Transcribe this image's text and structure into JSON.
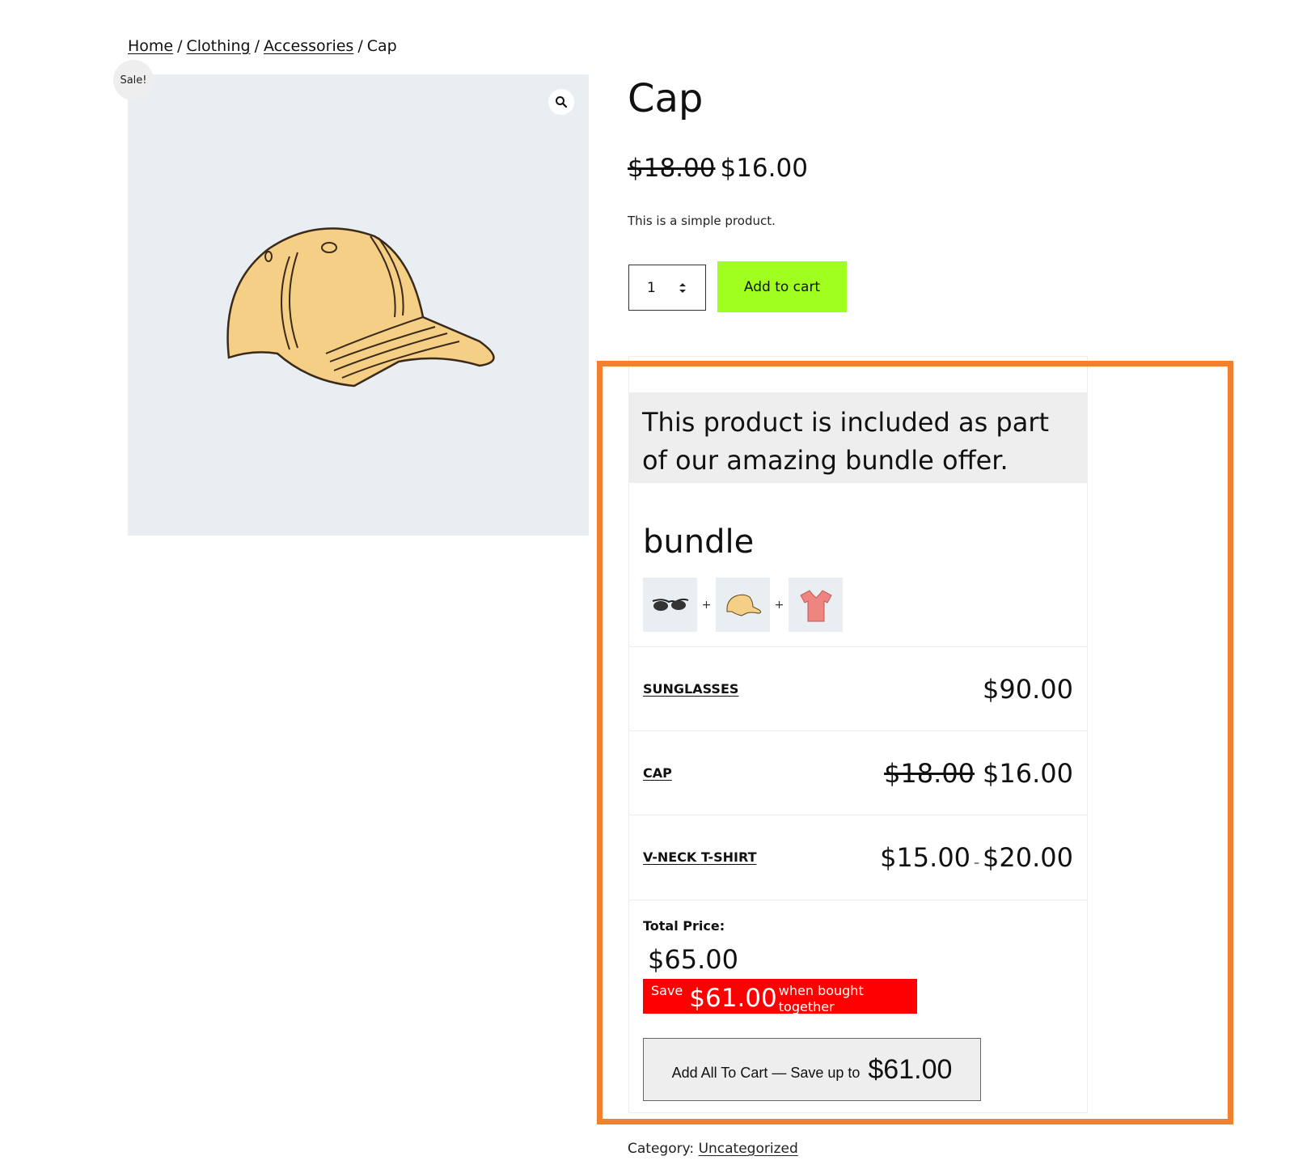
{
  "breadcrumb": {
    "home": "Home",
    "clothing": "Clothing",
    "accessories": "Accessories",
    "current": "Cap",
    "separator": "/"
  },
  "product": {
    "sale_badge": "Sale!",
    "title": "Cap",
    "price_old": "$18.00",
    "price_new": "$16.00",
    "short_description": "This is a simple product.",
    "quantity": "1",
    "add_to_cart_label": "Add to cart",
    "category_label": "Category:",
    "category_value": "Uncategorized"
  },
  "bundle": {
    "banner_text": "This product is included as part of our amazing bundle offer.",
    "title": "bundle",
    "thumb_separator": "+",
    "thumbnails": [
      "sunglasses-icon",
      "cap-icon",
      "t-shirt-icon"
    ],
    "items": [
      {
        "name": "SUNGLASSES",
        "price": "$90.00"
      },
      {
        "name": "CAP",
        "price_old": "$18.00",
        "price": "$16.00"
      },
      {
        "name": "V-NECK T-SHIRT",
        "price_min": "$15.00",
        "price_dash": "–",
        "price_max": "$20.00"
      }
    ],
    "total_label": "Total Price:",
    "total_value": "$65.00",
    "save_prefix": "Save",
    "save_amount": "$61.00",
    "save_suffix": "when bought together",
    "add_all_label": "Add All To Cart — Save up to",
    "add_all_amount": "$61.00"
  },
  "colors": {
    "add_to_cart_bg": "#a0ff1f",
    "highlight_border": "#f2802e",
    "save_badge_bg": "#ff0000",
    "image_bg": "#e9eef3"
  }
}
